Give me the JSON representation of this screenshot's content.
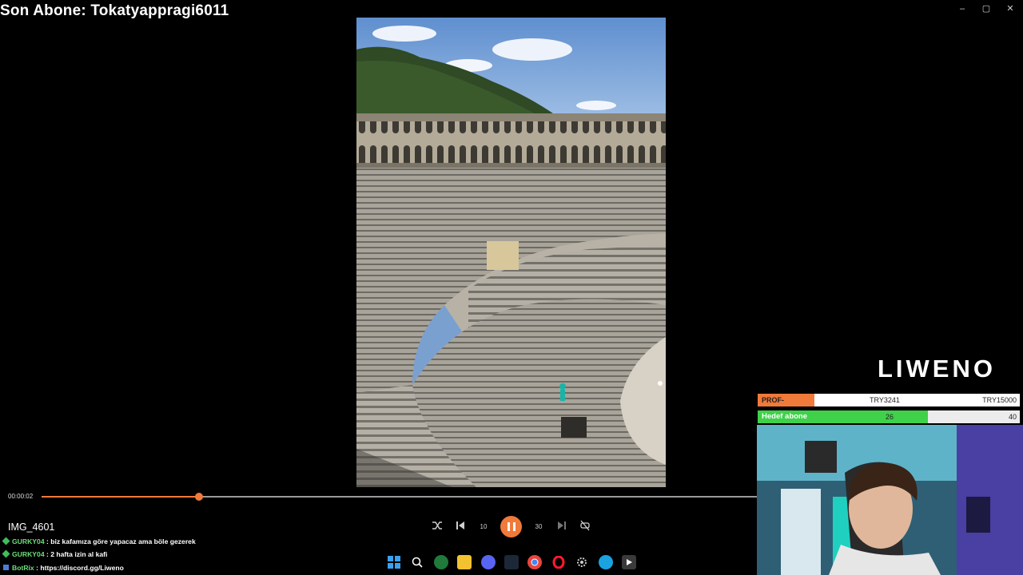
{
  "overlay": {
    "title": "Son Abone: Tokatyappragi6011"
  },
  "window": {
    "minimize": "–",
    "maximize": "▢",
    "close": "✕"
  },
  "player": {
    "current_time": "00:00:02",
    "progress_fraction": 0.22,
    "file_name": "IMG_4601",
    "accent_color": "#f07a3a",
    "controls": [
      "shuffle-icon",
      "previous-icon",
      "rewind-10-icon",
      "pause-icon",
      "forward-30-icon",
      "next-icon",
      "repeat-off-icon"
    ],
    "rewind_label": "10",
    "forward_label": "30"
  },
  "chat": [
    {
      "user": "GURKY04",
      "sep": " : ",
      "message": "biz kafamıza göre yapacaz ama böle gezerek"
    },
    {
      "user": "GURKY04",
      "sep": " : ",
      "message": "2 hafta izin al kafi"
    },
    {
      "user": "BotRix",
      "sep": " : ",
      "message": "https://discord.gg/Liweno"
    }
  ],
  "taskbar": {
    "items": [
      "windows-start-icon",
      "search-icon",
      "app-green-icon",
      "file-explorer-icon",
      "discord-icon",
      "steam-icon",
      "chrome-icon",
      "opera-icon",
      "settings-icon",
      "edge-icon",
      "media-player-icon"
    ]
  },
  "logo": {
    "text": "LIWENO"
  },
  "goals": {
    "donation": {
      "label": "PROF-KAMERA",
      "current": "TRY3241",
      "target": "TRY15000"
    },
    "subs": {
      "label": "Hedef abone",
      "current": "26",
      "target": "40",
      "fraction": 0.65
    }
  }
}
